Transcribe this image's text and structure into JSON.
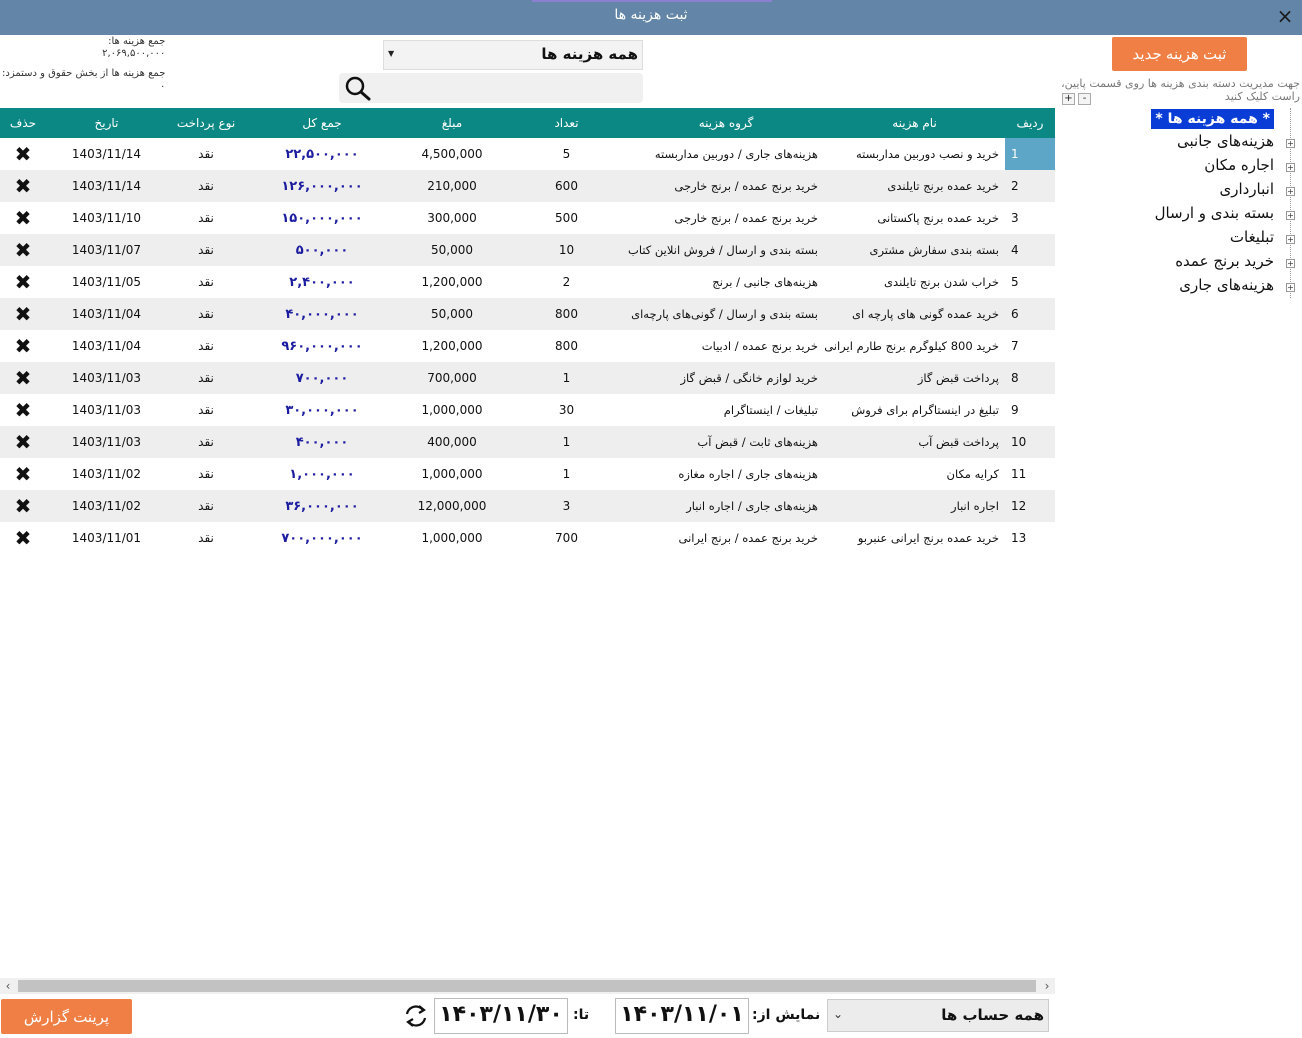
{
  "window": {
    "title": "ثبت هزینه ها",
    "close_icon": "×"
  },
  "totals": {
    "total_label": "جمع هزینه ها:",
    "total_value": "۲,۰۶۹,۵۰۰,۰۰۰",
    "salary_label": "جمع هزینه ها از بخش حقوق و دستمزد:",
    "salary_value": "۰"
  },
  "filter": {
    "group_value": "همه هزینه ها",
    "search_placeholder": ""
  },
  "table": {
    "headers": {
      "idx": "ردیف",
      "name": "نام هزینه",
      "group": "گروه هزینه",
      "count": "تعداد",
      "amount": "مبلغ",
      "total": "جمع کل",
      "payment": "نوع پرداخت",
      "date": "تاریخ",
      "delete": "حذف"
    },
    "delete_icon": "✖",
    "rows": [
      {
        "idx": "1",
        "name": "خرید و نصب دوربین مداربسته",
        "group": "هزینه‌های جاری / دوربین مداربسته",
        "count": "5",
        "amount": "4,500,000",
        "total": "۲۲,۵۰۰,۰۰۰",
        "payment": "نقد",
        "date": "1403/11/14"
      },
      {
        "idx": "2",
        "name": "خرید عمده برنج تایلندی",
        "group": "خرید برنج عمده / برنج خارجی",
        "count": "600",
        "amount": "210,000",
        "total": "۱۲۶,۰۰۰,۰۰۰",
        "payment": "نقد",
        "date": "1403/11/14"
      },
      {
        "idx": "3",
        "name": "خرید عمده برنج پاکستانی",
        "group": "خرید برنج عمده / برنج خارجی",
        "count": "500",
        "amount": "300,000",
        "total": "۱۵۰,۰۰۰,۰۰۰",
        "payment": "نقد",
        "date": "1403/11/10"
      },
      {
        "idx": "4",
        "name": "بسته بندی سفارش مشتری",
        "group": "بسته بندی و ارسال / فروش انلاین کتاب",
        "count": "10",
        "amount": "50,000",
        "total": "۵۰۰,۰۰۰",
        "payment": "نقد",
        "date": "1403/11/07"
      },
      {
        "idx": "5",
        "name": "خراب شدن برنج تایلندی",
        "group": "هزینه‌های جانبی / برنج",
        "count": "2",
        "amount": "1,200,000",
        "total": "۲,۴۰۰,۰۰۰",
        "payment": "نقد",
        "date": "1403/11/05"
      },
      {
        "idx": "6",
        "name": "خرید عمده گونی های پارچه ای",
        "group": "بسته بندی و ارسال / گونی‌های پارچه‌ای",
        "count": "800",
        "amount": "50,000",
        "total": "۴۰,۰۰۰,۰۰۰",
        "payment": "نقد",
        "date": "1403/11/04"
      },
      {
        "idx": "7",
        "name": "خرید 800 کیلوگرم برنج طارم ایرانی",
        "group": "خرید برنج عمده / ادبیات",
        "count": "800",
        "amount": "1,200,000",
        "total": "۹۶۰,۰۰۰,۰۰۰",
        "payment": "نقد",
        "date": "1403/11/04"
      },
      {
        "idx": "8",
        "name": "پرداخت قبض گاز",
        "group": "خرید لوازم خانگی / قبض گاز",
        "count": "1",
        "amount": "700,000",
        "total": "۷۰۰,۰۰۰",
        "payment": "نقد",
        "date": "1403/11/03"
      },
      {
        "idx": "9",
        "name": "تبلیغ در اینستاگرام برای فروش",
        "group": "تبلیغات / اینستاگرام",
        "count": "30",
        "amount": "1,000,000",
        "total": "۳۰,۰۰۰,۰۰۰",
        "payment": "نقد",
        "date": "1403/11/03"
      },
      {
        "idx": "10",
        "name": "پرداخت قبض آب",
        "group": "هزینه‌های ثابت / قبض آب",
        "count": "1",
        "amount": "400,000",
        "total": "۴۰۰,۰۰۰",
        "payment": "نقد",
        "date": "1403/11/03"
      },
      {
        "idx": "11",
        "name": "کرایه مکان",
        "group": "هزینه‌های جاری / اجاره مغازه",
        "count": "1",
        "amount": "1,000,000",
        "total": "۱,۰۰۰,۰۰۰",
        "payment": "نقد",
        "date": "1403/11/02"
      },
      {
        "idx": "12",
        "name": "اجاره انبار",
        "group": "هزینه‌های جاری / اجاره انبار",
        "count": "3",
        "amount": "12,000,000",
        "total": "۳۶,۰۰۰,۰۰۰",
        "payment": "نقد",
        "date": "1403/11/02"
      },
      {
        "idx": "13",
        "name": "خرید عمده برنج ایرانی عنبربو",
        "group": "خرید برنج عمده / برنج ایرانی",
        "count": "700",
        "amount": "1,000,000",
        "total": "۷۰۰,۰۰۰,۰۰۰",
        "payment": "نقد",
        "date": "1403/11/01"
      }
    ]
  },
  "right_panel": {
    "new_button": "ثبت هزینه جدید",
    "hint": "جهت مدیریت دسته بندی هزینه ها روی قسمت پایین، راست کلیک کنید",
    "expand_label": "+",
    "collapse_label": "-",
    "tree_root": "* همه هزینه ها *",
    "tree_items": [
      "هزینه‌های جانبی",
      "اجاره مکان",
      "انبارداری",
      "بسته بندی و ارسال",
      "تبلیغات",
      "خرید برنج عمده",
      "هزینه‌های جاری"
    ],
    "tree_plus": "+"
  },
  "bottom": {
    "print_button": "پرینت گزارش",
    "to_label": "تا:",
    "to_date": "۱۴۰۳/۱۱/۳۰",
    "from_label": "نمایش از:",
    "from_date": "۱۴۰۳/۱۱/۰۱",
    "account_value": "همه حساب ها"
  },
  "colors": {
    "title_bar": "#6386a8",
    "header": "#0b8884",
    "accent_button": "#f07f45",
    "selected_tree": "#0a3cd6",
    "total_text": "#1c1ca0"
  }
}
